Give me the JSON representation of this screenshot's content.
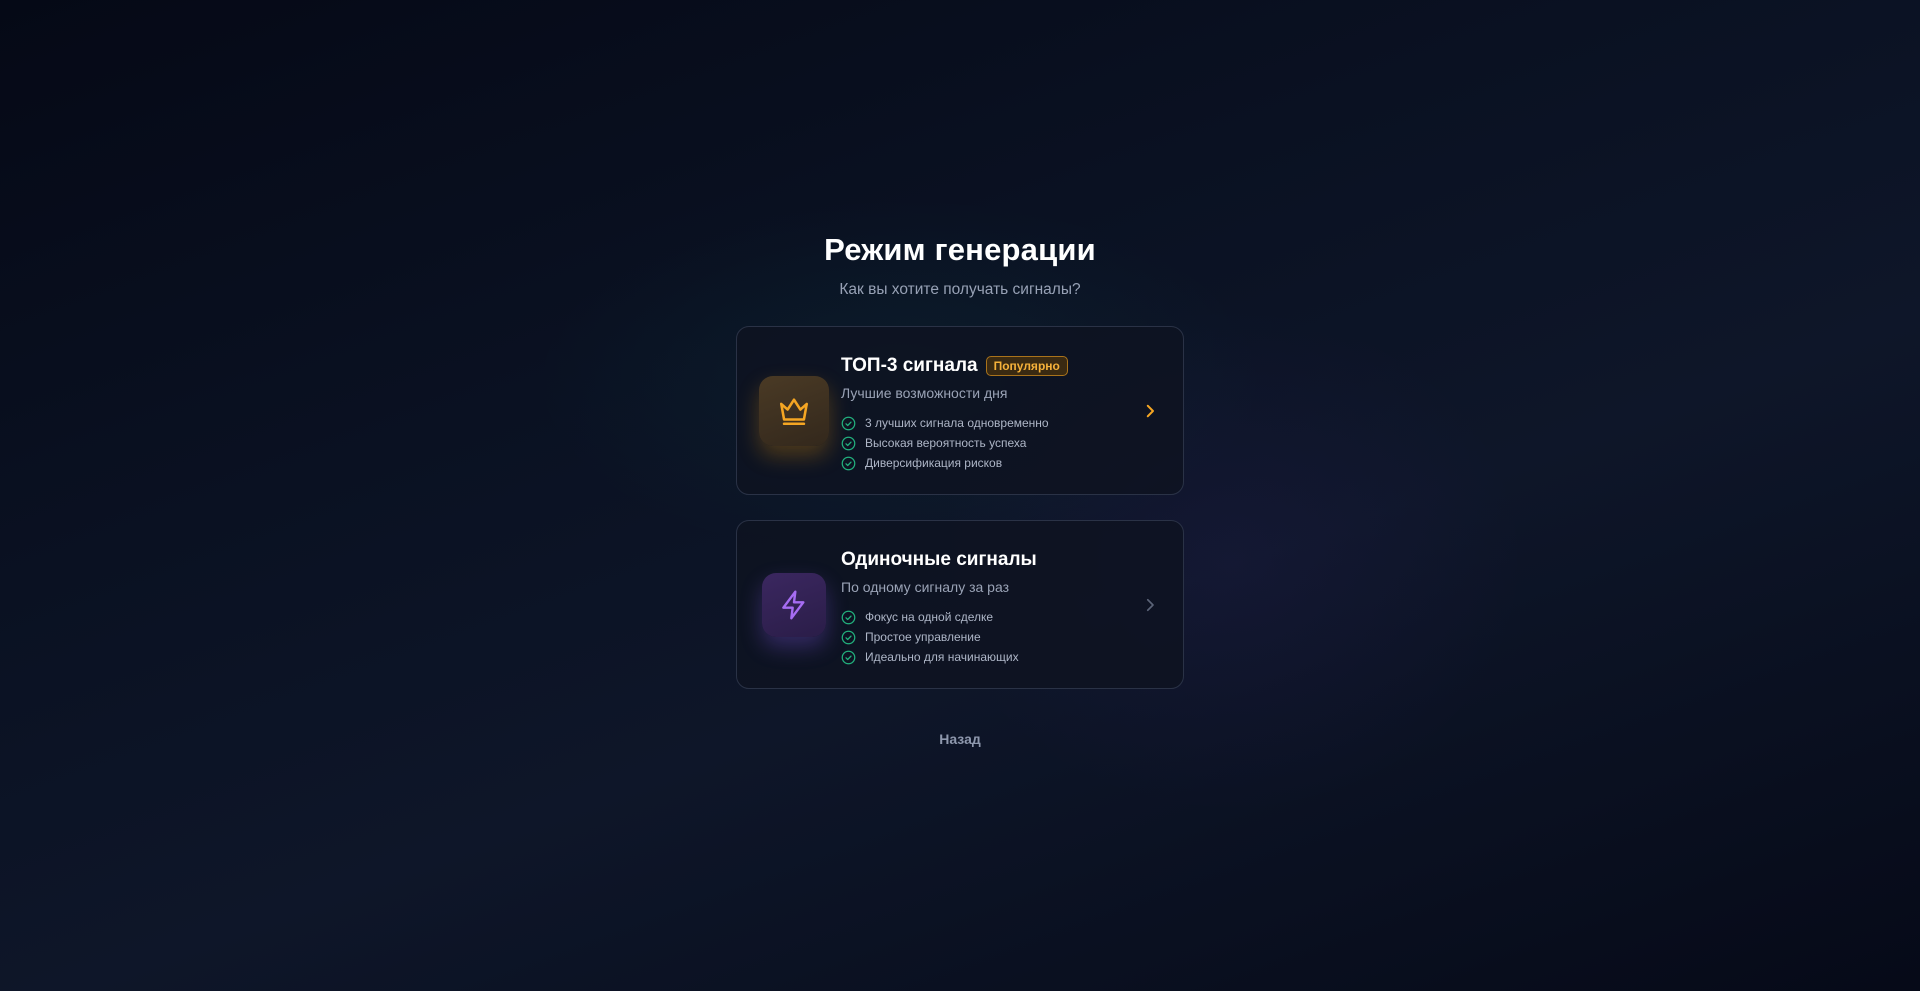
{
  "header": {
    "title": "Режим генерации",
    "subtitle": "Как вы хотите получать сигналы?"
  },
  "modes": [
    {
      "title": "ТОП-3 сигнала",
      "badge": "Популярно",
      "description": "Лучшие возможности дня",
      "icon": "crown-icon",
      "accent": "#f5a623",
      "features": [
        "3 лучших сигнала одновременно",
        "Высокая вероятность успеха",
        "Диверсификация рисков"
      ]
    },
    {
      "title": "Одиночные сигналы",
      "description": "По одному сигналу за раз",
      "icon": "lightning-icon",
      "accent": "#a66cf2",
      "features": [
        "Фокус на одной сделке",
        "Простое управление",
        "Идеально для начинающих"
      ]
    }
  ],
  "footer": {
    "back_label": "Назад"
  },
  "colors": {
    "check": "#22b07d",
    "chevron_active": "#f5a623",
    "chevron_inactive": "#5b6478"
  }
}
